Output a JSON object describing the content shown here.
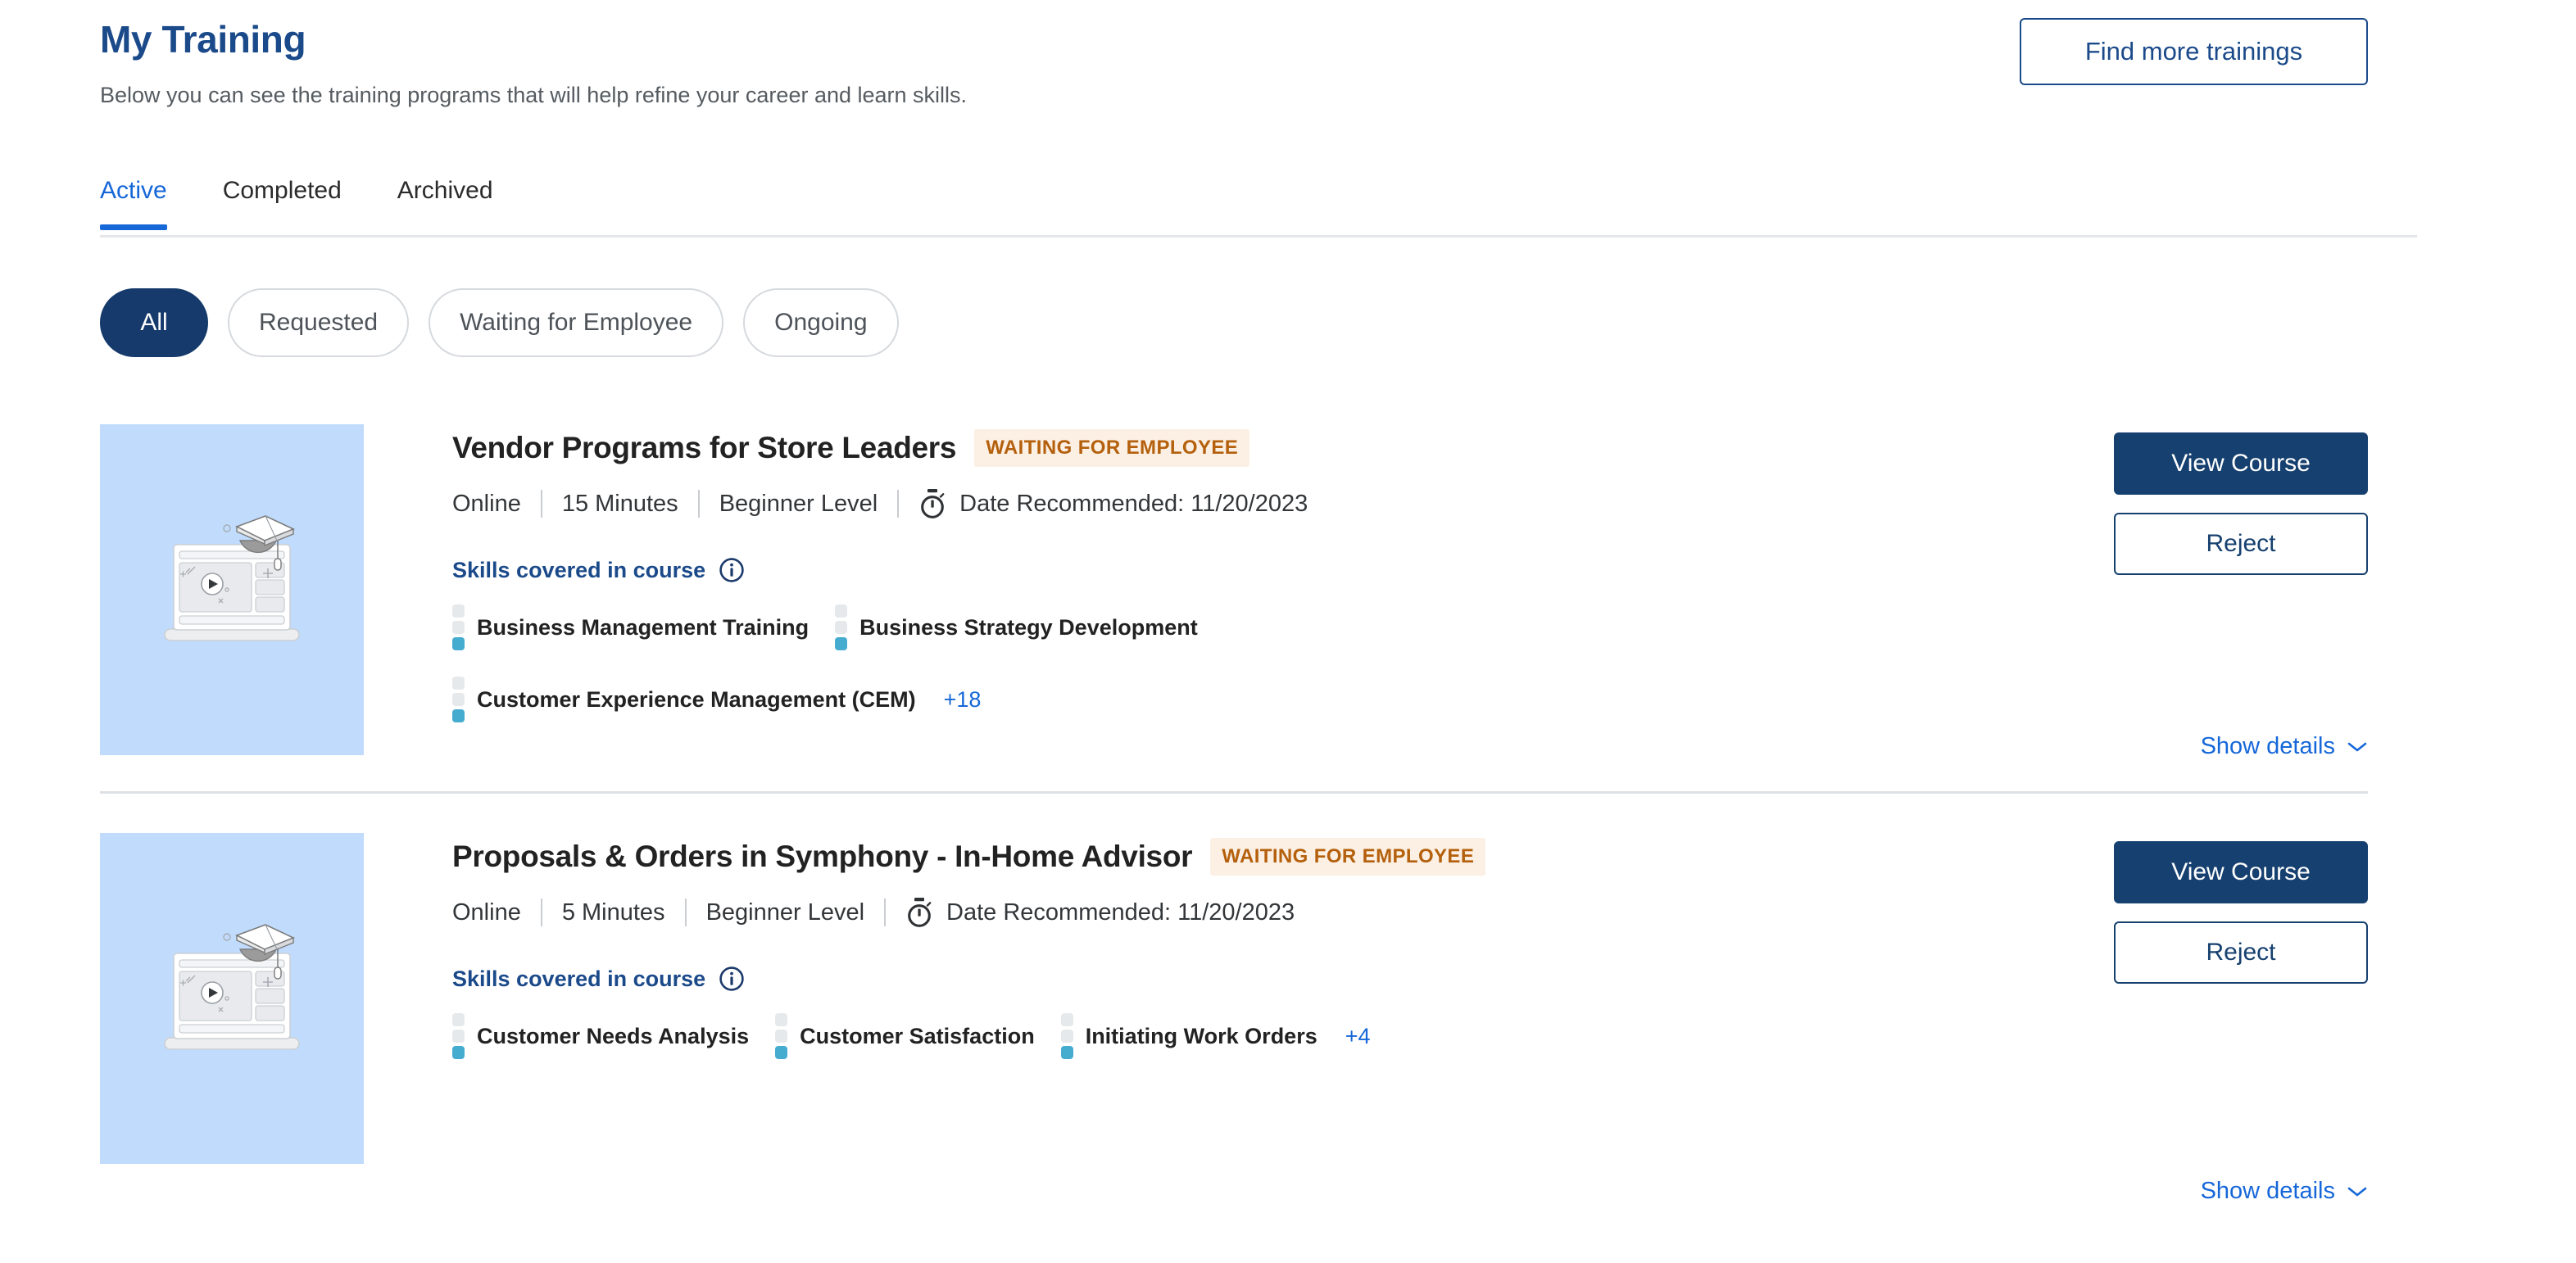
{
  "header": {
    "title": "My Training",
    "subtitle": "Below you can see the training programs that will help refine your career and learn skills.",
    "find_more_label": "Find more trainings"
  },
  "tabs": [
    {
      "label": "Active",
      "active": true
    },
    {
      "label": "Completed",
      "active": false
    },
    {
      "label": "Archived",
      "active": false
    }
  ],
  "filters": [
    {
      "label": "All",
      "selected": true
    },
    {
      "label": "Requested",
      "selected": false
    },
    {
      "label": "Waiting for Employee",
      "selected": false
    },
    {
      "label": "Ongoing",
      "selected": false
    }
  ],
  "common": {
    "skills_label": "Skills covered in course",
    "info_icon": "info-icon",
    "stopwatch_icon": "stopwatch-icon",
    "chevron_icon": "chevron-down-icon",
    "thumbnail_icon": "online-course-illustration",
    "show_details_label": "Show details",
    "view_course_label": "View Course",
    "reject_label": "Reject"
  },
  "colors": {
    "title_blue": "#1b4a8a",
    "tab_active_blue": "#1667d8",
    "pill_selected": "#153a6b",
    "badge_bg": "#fcf0e4",
    "badge_text": "#b4600c",
    "primary_button": "#16406f",
    "link_blue": "#1667d8",
    "skill_filled": "#45acd0",
    "skill_empty": "#e6e9ec",
    "thumbnail_bg": "#c0dbfc"
  },
  "courses": [
    {
      "title": "Vendor Programs for Store Leaders",
      "status": "WAITING FOR EMPLOYEE",
      "format": "Online",
      "duration": "15 Minutes",
      "level": "Beginner Level",
      "date_recommended": "Date Recommended: 11/20/2023",
      "skills_row1": [
        "Business Management Training",
        "Business Strategy Development"
      ],
      "skills_row2": [
        "Customer Experience Management (CEM)"
      ],
      "skills_more": "+18"
    },
    {
      "title": "Proposals & Orders in Symphony - In-Home Advisor",
      "status": "WAITING FOR EMPLOYEE",
      "format": "Online",
      "duration": "5 Minutes",
      "level": "Beginner Level",
      "date_recommended": "Date Recommended: 11/20/2023",
      "skills_row1": [
        "Customer Needs Analysis",
        "Customer Satisfaction",
        "Initiating Work Orders"
      ],
      "skills_row2": [],
      "skills_more": "+4"
    }
  ]
}
